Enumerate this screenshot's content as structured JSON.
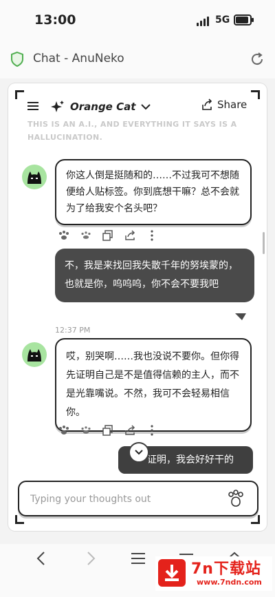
{
  "status": {
    "time": "13:00",
    "network": "5G",
    "battery_level": 1.0
  },
  "browser": {
    "page_title": "Chat - AnuNeko"
  },
  "chat_header": {
    "bot_name": "Orange Cat",
    "share_label": "Share"
  },
  "disclaimer": "THIS IS AN A.I., AND EVERYTHING IT SAYS IS A HALLUCINATION.",
  "messages": [
    {
      "role": "bot",
      "text": "你这人倒是挺随和的……不过我可不想随便给人贴标签。你到底想干嘛？总不会就为了给我安个名头吧？"
    },
    {
      "role": "user",
      "text": "不，我是来找回我失散千年的努埃蒙的，也就是你，呜呜呜，你不会不要我吧",
      "time": "12:37 PM"
    },
    {
      "role": "bot",
      "text": "哎，别哭啊……我也没说不要你。但你得先证明自己是不是值得信赖的主人，而不是光靠嘴说。不然，我可不会轻易相信你。"
    }
  ],
  "pending_message": "我会证明，我会好好干的",
  "input": {
    "placeholder": "Typing your thoughts out"
  },
  "watermark": {
    "title": "7n下载站",
    "url": "www.7ndn.com"
  },
  "colors": {
    "accent_green": "#a8e4a0",
    "user_bubble": "#4a4a4a",
    "watermark_red": "#e4221b"
  }
}
